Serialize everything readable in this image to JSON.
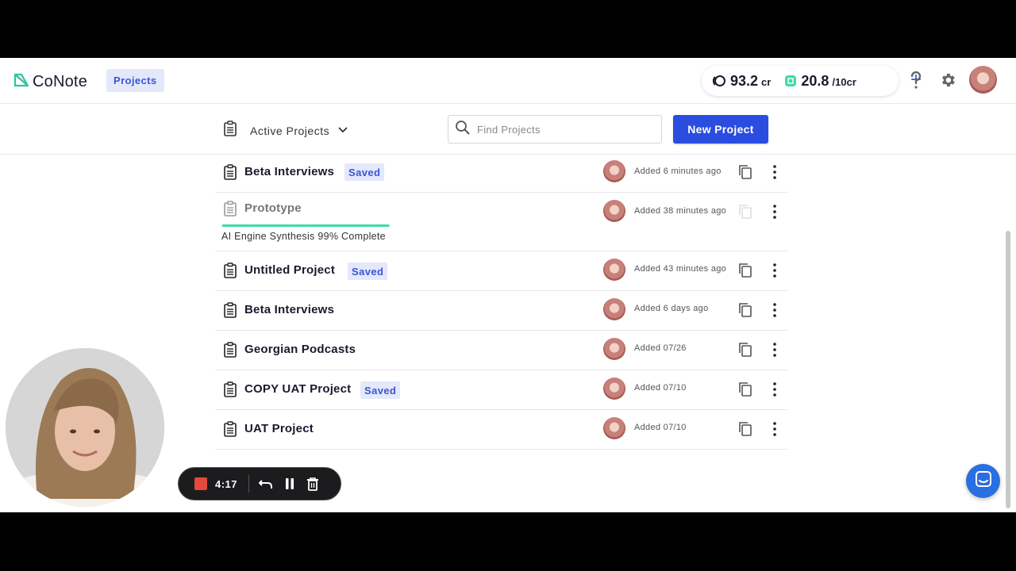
{
  "app": {
    "name": "CoNote",
    "nav_tab": "Projects"
  },
  "credits": {
    "primary_value": "93.2",
    "primary_unit": "cr",
    "secondary_value": "20.8",
    "secondary_unit": "/10cr"
  },
  "toolbar": {
    "filter_label": "Active Projects",
    "search_placeholder": "Find Projects",
    "new_project_label": "New Project"
  },
  "projects": [
    {
      "title": "Beta Interviews",
      "badge": "Saved",
      "added": "Added 6 minutes ago"
    },
    {
      "title": "Prototype",
      "badge": "",
      "added": "Added 38 minutes ago",
      "progress_label": "AI Engine Synthesis 99% Complete",
      "progress": 0.99
    },
    {
      "title": "Untitled Project",
      "badge": "Saved",
      "added": "Added 43 minutes ago"
    },
    {
      "title": "Beta Interviews",
      "badge": "",
      "added": "Added 6 days ago"
    },
    {
      "title": "Georgian Podcasts",
      "badge": "",
      "added": "Added 07/26"
    },
    {
      "title": "COPY UAT Project",
      "badge": "Saved",
      "added": "Added 07/10"
    },
    {
      "title": "UAT Project",
      "badge": "",
      "added": "Added 07/10"
    }
  ],
  "recorder": {
    "time": "4:17"
  },
  "colors": {
    "accent": "#2a4de0",
    "badge_bg": "#e3e8fb",
    "badge_text": "#3b55d6",
    "progress": "#3ddba8",
    "logo": "#2ec4a0",
    "record": "#e5483d"
  }
}
